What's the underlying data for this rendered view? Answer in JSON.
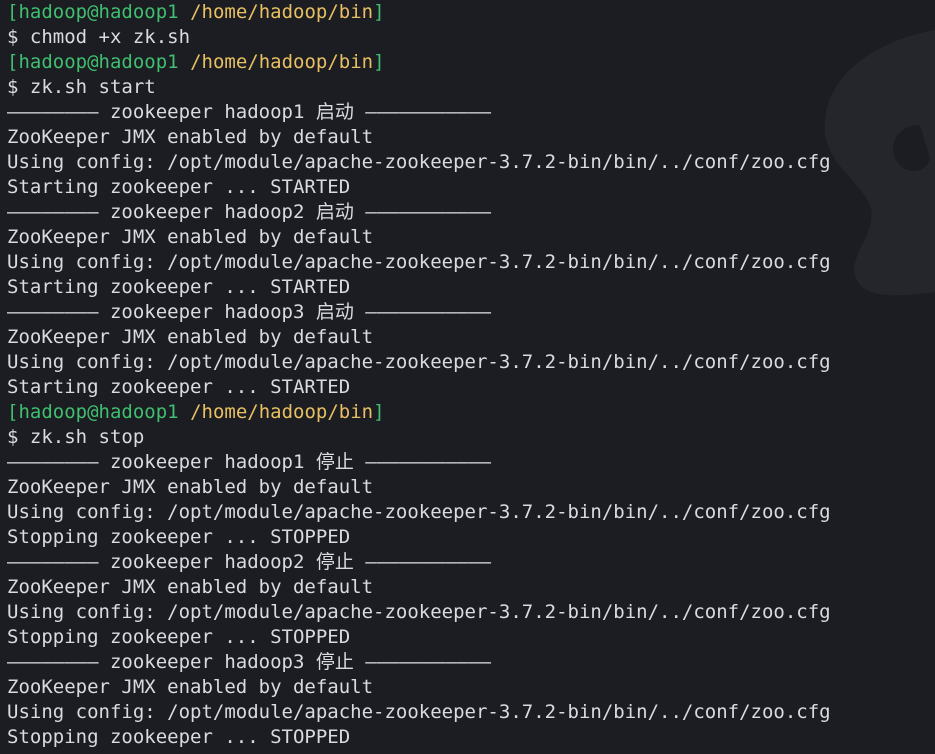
{
  "prompt": {
    "user_host": "hadoop@hadoop1",
    "cwd": "/home/hadoop/bin"
  },
  "lines": [
    {
      "kind": "prompt"
    },
    {
      "kind": "cmd",
      "text": "$ chmod +x zk.sh"
    },
    {
      "kind": "prompt"
    },
    {
      "kind": "cmd",
      "text": "$ zk.sh start"
    },
    {
      "kind": "sep",
      "text": "———————— zookeeper hadoop1 启动 ———————————"
    },
    {
      "kind": "out",
      "text": "ZooKeeper JMX enabled by default"
    },
    {
      "kind": "out",
      "text": "Using config: /opt/module/apache-zookeeper-3.7.2-bin/bin/../conf/zoo.cfg"
    },
    {
      "kind": "out",
      "text": "Starting zookeeper ... STARTED"
    },
    {
      "kind": "sep",
      "text": "———————— zookeeper hadoop2 启动 ———————————"
    },
    {
      "kind": "out",
      "text": "ZooKeeper JMX enabled by default"
    },
    {
      "kind": "out",
      "text": "Using config: /opt/module/apache-zookeeper-3.7.2-bin/bin/../conf/zoo.cfg"
    },
    {
      "kind": "out",
      "text": "Starting zookeeper ... STARTED"
    },
    {
      "kind": "sep",
      "text": "———————— zookeeper hadoop3 启动 ———————————"
    },
    {
      "kind": "out",
      "text": "ZooKeeper JMX enabled by default"
    },
    {
      "kind": "out",
      "text": "Using config: /opt/module/apache-zookeeper-3.7.2-bin/bin/../conf/zoo.cfg"
    },
    {
      "kind": "out",
      "text": "Starting zookeeper ... STARTED"
    },
    {
      "kind": "prompt"
    },
    {
      "kind": "cmd",
      "text": "$ zk.sh stop"
    },
    {
      "kind": "sep",
      "text": "———————— zookeeper hadoop1 停止 ———————————"
    },
    {
      "kind": "out",
      "text": "ZooKeeper JMX enabled by default"
    },
    {
      "kind": "out",
      "text": "Using config: /opt/module/apache-zookeeper-3.7.2-bin/bin/../conf/zoo.cfg"
    },
    {
      "kind": "out",
      "text": "Stopping zookeeper ... STOPPED"
    },
    {
      "kind": "sep",
      "text": "———————— zookeeper hadoop2 停止 ———————————"
    },
    {
      "kind": "out",
      "text": "ZooKeeper JMX enabled by default"
    },
    {
      "kind": "out",
      "text": "Using config: /opt/module/apache-zookeeper-3.7.2-bin/bin/../conf/zoo.cfg"
    },
    {
      "kind": "out",
      "text": "Stopping zookeeper ... STOPPED"
    },
    {
      "kind": "sep",
      "text": "———————— zookeeper hadoop3 停止 ———————————"
    },
    {
      "kind": "out",
      "text": "ZooKeeper JMX enabled by default"
    },
    {
      "kind": "out",
      "text": "Using config: /opt/module/apache-zookeeper-3.7.2-bin/bin/../conf/zoo.cfg"
    },
    {
      "kind": "out",
      "text": "Stopping zookeeper ... STOPPED"
    }
  ],
  "colors": {
    "background": "#1c1d22",
    "text": "#dadbe0",
    "prompt_user": "#3fbf6f",
    "prompt_path": "#e8c061"
  },
  "icons": {
    "watermark": "terminal-logo-watermark-icon"
  }
}
